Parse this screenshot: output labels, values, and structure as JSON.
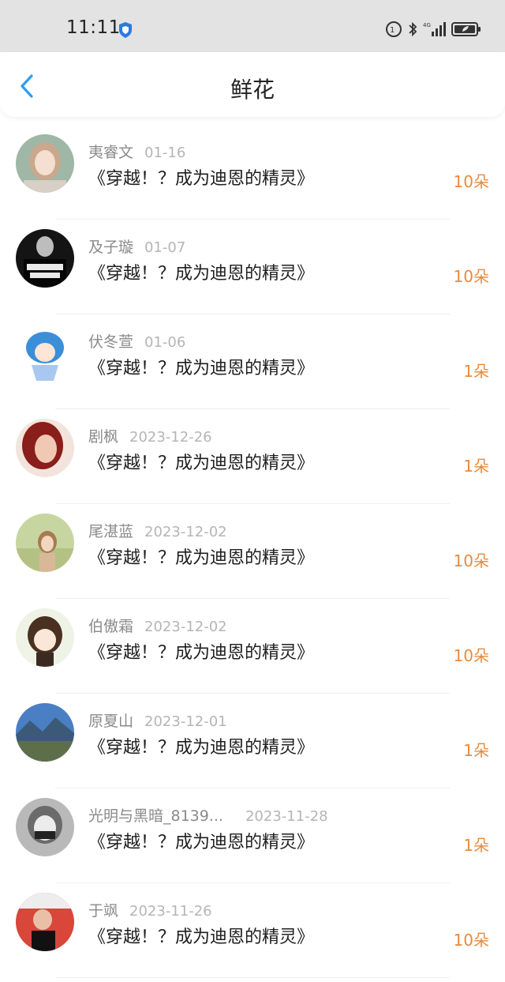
{
  "status": {
    "time": "11:11"
  },
  "header": {
    "title": "鲜花"
  },
  "items": [
    {
      "name": "夷睿文",
      "date": "01-16",
      "book": "《穿越！？成为迪恩的精灵》",
      "count": "10朵",
      "avatar": "avatar-girl-1"
    },
    {
      "name": "及子璇",
      "date": "01-07",
      "book": "《穿越！？成为迪恩的精灵》",
      "count": "10朵",
      "avatar": "avatar-dark-shirt"
    },
    {
      "name": "伏冬萱",
      "date": "01-06",
      "book": "《穿越！？成为迪恩的精灵》",
      "count": "1朵",
      "avatar": "avatar-anime-blue"
    },
    {
      "name": "剧枫",
      "date": "2023-12-26",
      "book": "《穿越！？成为迪恩的精灵》",
      "count": "1朵",
      "avatar": "avatar-redhead"
    },
    {
      "name": "尾湛蓝",
      "date": "2023-12-02",
      "book": "《穿越！？成为迪恩的精灵》",
      "count": "10朵",
      "avatar": "avatar-outdoor-girl"
    },
    {
      "name": "伯傲霜",
      "date": "2023-12-02",
      "book": "《穿越！？成为迪恩的精灵》",
      "count": "10朵",
      "avatar": "avatar-anime-brown"
    },
    {
      "name": "原夏山",
      "date": "2023-12-01",
      "book": "《穿越！？成为迪恩的精灵》",
      "count": "1朵",
      "avatar": "avatar-landscape"
    },
    {
      "name": "光明与黑暗_8139...",
      "date": "2023-11-28",
      "book": "《穿越！？成为迪恩的精灵》",
      "count": "1朵",
      "avatar": "avatar-masked"
    },
    {
      "name": "于飒",
      "date": "2023-11-26",
      "book": "《穿越！？成为迪恩的精灵》",
      "count": "10朵",
      "avatar": "avatar-red-cap"
    }
  ]
}
